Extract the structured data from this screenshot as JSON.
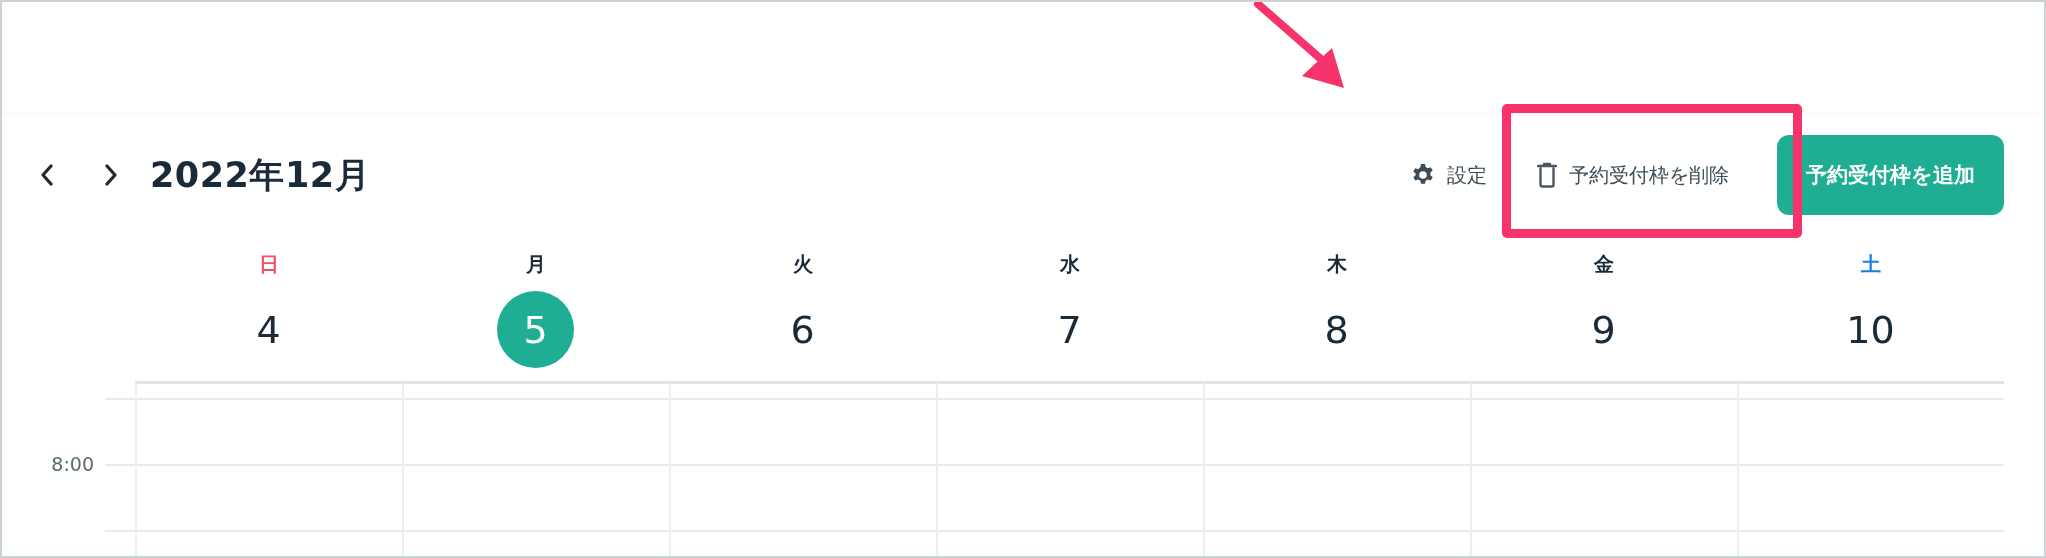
{
  "toolbar": {
    "title": "2022年12月",
    "actions": [
      {
        "kind": "settings",
        "label": "設定",
        "highlighted": false
      },
      {
        "kind": "delete",
        "label": "予約受付枠を削除",
        "highlighted": true
      },
      {
        "kind": "primary",
        "label": "予約受付枠を追加",
        "highlighted": false
      }
    ]
  },
  "days": [
    {
      "weekday": "日",
      "date": "4",
      "kind": "sunday",
      "today": false
    },
    {
      "weekday": "月",
      "date": "5",
      "kind": "weekday",
      "today": true
    },
    {
      "weekday": "火",
      "date": "6",
      "kind": "weekday",
      "today": false
    },
    {
      "weekday": "水",
      "date": "7",
      "kind": "weekday",
      "today": false
    },
    {
      "weekday": "木",
      "date": "8",
      "kind": "weekday",
      "today": false
    },
    {
      "weekday": "金",
      "date": "9",
      "kind": "weekday",
      "today": false
    },
    {
      "weekday": "土",
      "date": "10",
      "kind": "saturday",
      "today": false
    }
  ],
  "time_labels": [
    "8:00"
  ]
}
